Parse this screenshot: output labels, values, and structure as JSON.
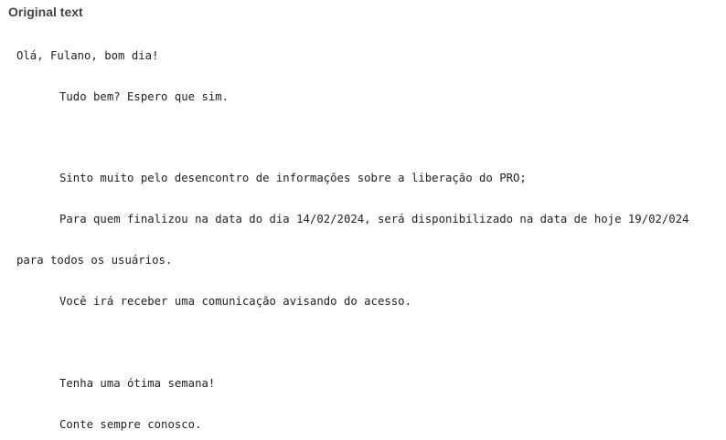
{
  "panel": {
    "header": "Original text"
  },
  "message": {
    "greeting": "Olá, Fulano, bom dia!",
    "line_1": "Tudo bem? Espero que sim.",
    "line_2": "Sinto muito pelo desencontro de informações sobre a liberação do PRO;",
    "line_3": "Para quem finalizou na data do dia 14/02/2024, será disponibilizado na data de hoje 19/02/024",
    "line_4": "para todos os usuários.",
    "line_5": "Você irá receber uma comunicação avisando do acesso.",
    "line_6": "Tenha uma ótima semana!",
    "line_7": "Conte sempre conosco."
  }
}
